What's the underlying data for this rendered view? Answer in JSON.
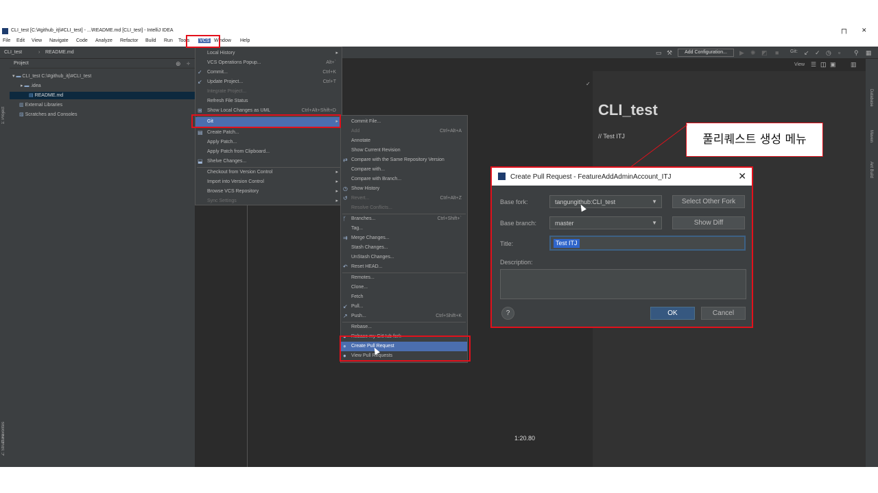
{
  "window": {
    "title": "CLI_test [C:\\#github_itj\\#CLI_test] - ...\\README.md [CLI_test] - IntelliJ IDEA",
    "controls": [
      "ㄇ",
      "✕"
    ]
  },
  "menubar": {
    "items": [
      "File",
      "Edit",
      "View",
      "Navigate",
      "Code",
      "Analyze",
      "Refactor",
      "Build",
      "Run",
      "Tools",
      "VCS",
      "Window",
      "Help"
    ],
    "active": "VCS"
  },
  "navbar": {
    "breadcrumb": [
      "CLI_test",
      "README.md"
    ],
    "run_config": "Add Configuration...",
    "git_label": "Git:"
  },
  "project": {
    "header": "Project",
    "tree": [
      {
        "label": "CLI_test  C:\\#github_itj\\#CLI_test",
        "level": 0
      },
      {
        "label": ".idea",
        "level": 1
      },
      {
        "label": "README.md",
        "level": 2
      },
      {
        "label": "External Libraries",
        "level": 0
      },
      {
        "label": "Scratches and Consoles",
        "level": 0
      }
    ]
  },
  "left_tabs": [
    "1: Project",
    "2: Favorites",
    "Z: Structure"
  ],
  "right_tabs": [
    "Database",
    "Maven",
    "Ant Build"
  ],
  "vcs_menu": {
    "items": [
      {
        "label": "Local History",
        "shortcut": "",
        "submenu": true,
        "disabled": false
      },
      {
        "label": "VCS Operations Popup...",
        "shortcut": "Alt+`",
        "submenu": false,
        "disabled": false
      },
      {
        "label": "Commit...",
        "shortcut": "Ctrl+K",
        "submenu": false,
        "disabled": false,
        "icon": "✓"
      },
      {
        "label": "Update Project...",
        "shortcut": "Ctrl+T",
        "submenu": false,
        "disabled": false,
        "icon": "↙"
      },
      {
        "label": "Integrate Project...",
        "shortcut": "",
        "submenu": false,
        "disabled": true
      },
      {
        "label": "Refresh File Status",
        "shortcut": "",
        "submenu": false,
        "disabled": false
      },
      {
        "label": "Show Local Changes as UML",
        "shortcut": "Ctrl+Alt+Shift+D",
        "submenu": false,
        "disabled": false,
        "icon": "⊞"
      },
      {
        "label": "Git",
        "shortcut": "",
        "submenu": true,
        "disabled": false,
        "highlighted": true
      },
      {
        "label": "Create Patch...",
        "shortcut": "",
        "submenu": false,
        "disabled": false,
        "icon": "▤"
      },
      {
        "label": "Apply Patch...",
        "shortcut": "",
        "submenu": false,
        "disabled": false
      },
      {
        "label": "Apply Patch from Clipboard...",
        "shortcut": "",
        "submenu": false,
        "disabled": false
      },
      {
        "label": "Shelve Changes...",
        "shortcut": "",
        "submenu": false,
        "disabled": false,
        "icon": "⬓"
      },
      {
        "label": "Checkout from Version Control",
        "shortcut": "",
        "submenu": true,
        "disabled": false
      },
      {
        "label": "Import into Version Control",
        "shortcut": "",
        "submenu": true,
        "disabled": false
      },
      {
        "label": "Browse VCS Repository",
        "shortcut": "",
        "submenu": true,
        "disabled": false
      },
      {
        "label": "Sync Settings",
        "shortcut": "",
        "submenu": true,
        "disabled": true
      }
    ]
  },
  "git_menu": {
    "items": [
      {
        "label": "Commit File...",
        "shortcut": "",
        "disabled": false
      },
      {
        "label": "Add",
        "shortcut": "Ctrl+Alt+A",
        "disabled": true
      },
      {
        "label": "Annotate",
        "shortcut": "",
        "disabled": false
      },
      {
        "label": "Show Current Revision",
        "shortcut": "",
        "disabled": false
      },
      {
        "label": "Compare with the Same Repository Version",
        "shortcut": "",
        "disabled": false,
        "icon": "⇄"
      },
      {
        "label": "Compare with...",
        "shortcut": "",
        "disabled": false
      },
      {
        "label": "Compare with Branch...",
        "shortcut": "",
        "disabled": false
      },
      {
        "label": "Show History",
        "shortcut": "",
        "disabled": false,
        "icon": "◷"
      },
      {
        "label": "Revert...",
        "shortcut": "Ctrl+Alt+Z",
        "disabled": true,
        "icon": "↺"
      },
      {
        "label": "Resolve Conflicts...",
        "shortcut": "",
        "disabled": true
      },
      {
        "label": "Branches...",
        "shortcut": "Ctrl+Shift+`",
        "disabled": false,
        "icon": "ᚶ"
      },
      {
        "label": "Tag...",
        "shortcut": "",
        "disabled": false
      },
      {
        "label": "Merge Changes...",
        "shortcut": "",
        "disabled": false,
        "icon": "⇉"
      },
      {
        "label": "Stash Changes...",
        "shortcut": "",
        "disabled": false
      },
      {
        "label": "UnStash Changes...",
        "shortcut": "",
        "disabled": false
      },
      {
        "label": "Reset HEAD...",
        "shortcut": "",
        "disabled": false,
        "icon": "↶"
      },
      {
        "label": "Remotes...",
        "shortcut": "",
        "disabled": false
      },
      {
        "label": "Clone...",
        "shortcut": "",
        "disabled": false
      },
      {
        "label": "Fetch",
        "shortcut": "",
        "disabled": false
      },
      {
        "label": "Pull...",
        "shortcut": "",
        "disabled": false,
        "icon": "↙"
      },
      {
        "label": "Push...",
        "shortcut": "Ctrl+Shift+K",
        "disabled": false,
        "icon": "↗"
      },
      {
        "label": "Rebase...",
        "shortcut": "",
        "disabled": false
      },
      {
        "label": "Rebase my GitHub fork",
        "shortcut": "",
        "disabled": false,
        "icon": "●"
      },
      {
        "label": "Create Pull Request",
        "shortcut": "",
        "disabled": false,
        "icon": "●",
        "highlighted": true
      },
      {
        "label": "View Pull Requests",
        "shortcut": "",
        "disabled": false,
        "icon": "●"
      }
    ]
  },
  "preview": {
    "heading": "CLI_test",
    "body": "// Test ITJ",
    "view_label": "View"
  },
  "dialog": {
    "title": "Create Pull Request - FeatureAddAdminAccount_ITJ",
    "base_fork_label": "Base fork:",
    "base_fork_value": "tangungithub:CLI_test",
    "select_fork_button": "Select Other Fork",
    "base_branch_label": "Base branch:",
    "base_branch_value": "master",
    "show_diff_button": "Show Diff",
    "title_label": "Title:",
    "title_value": "Test ITJ",
    "description_label": "Description:",
    "help": "?",
    "ok": "OK",
    "cancel": "Cancel"
  },
  "annotation": {
    "callout": "풀리퀘스트 생성 메뉴"
  },
  "timestamp": "1:20.80",
  "colors": {
    "highlight": "#e3101b",
    "menu_select": "#4b6eaf",
    "ide_bg": "#2b2b2b",
    "panel_bg": "#3c3f41"
  }
}
